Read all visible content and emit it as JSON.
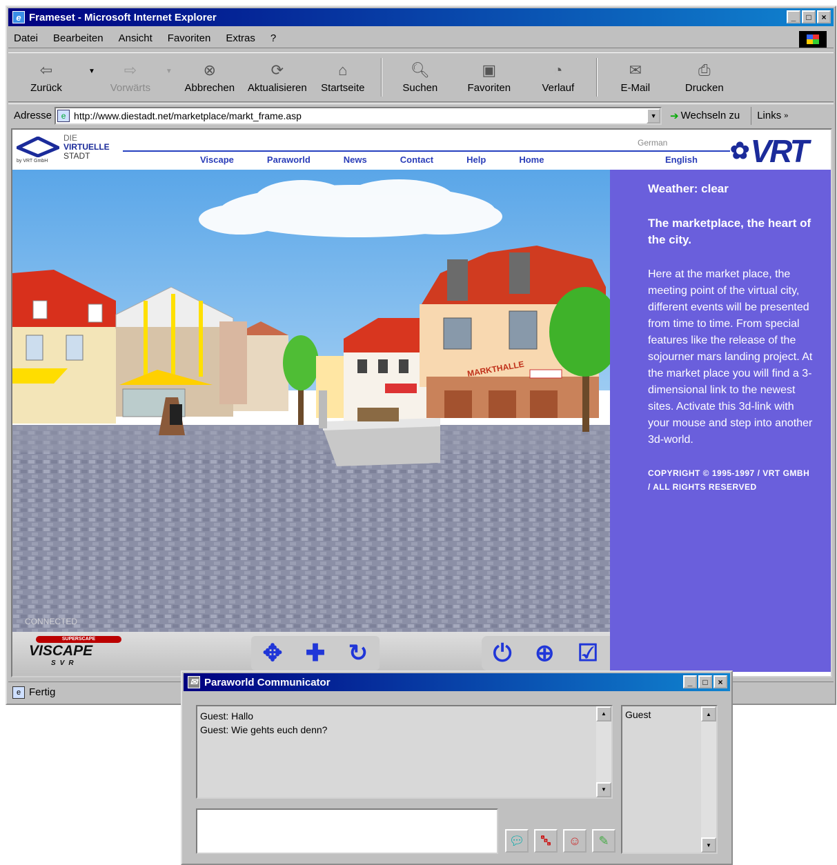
{
  "window": {
    "title": "Frameset - Microsoft Internet Explorer",
    "controls": [
      "_",
      "□",
      "×"
    ]
  },
  "menu": [
    "Datei",
    "Bearbeiten",
    "Ansicht",
    "Favoriten",
    "Extras",
    "?"
  ],
  "toolbar": {
    "back": "Zurück",
    "forward": "Vorwärts",
    "stop": "Abbrechen",
    "refresh": "Aktualisieren",
    "home": "Startseite",
    "search": "Suchen",
    "favorites": "Favoriten",
    "history": "Verlauf",
    "mail": "E-Mail",
    "print": "Drucken"
  },
  "address": {
    "label": "Adresse",
    "url": "http://www.diestadt.net/marketplace/markt_frame.asp",
    "go": "Wechseln zu",
    "links": "Links"
  },
  "site": {
    "logo_die": "DIE",
    "logo_virtuelle": "VIRTUELLE",
    "logo_stadt": "STADT",
    "logo_sub": "by VRT GmbH",
    "nav": [
      "Viscape",
      "Paraworld",
      "News",
      "Contact",
      "Help",
      "Home"
    ],
    "lang_german": "German",
    "lang_english": "English",
    "brand": "VRT"
  },
  "sidebar": {
    "weather": "Weather: clear",
    "heading": "The marketplace, the heart of the city.",
    "body": "Here at the market place, the meeting point of the virtual city, different events will be presented from time to time. From special features like the release of the sojourner mars landing project. At the market place you will find a 3-dimensional link to the newest sites. Activate this 3d-link with your mouse and step into another 3d-world.",
    "copyright": "COPYRIGHT © 1995-1997 / VRT GMBH / ALL RIGHTS RESERVED"
  },
  "scene": {
    "connected": "CONNECTED",
    "sign_markthalle": "MARKTHALLE"
  },
  "viscape": {
    "top": "SUPERSCAPE",
    "name": "VISCAPE",
    "bottom": "SVR"
  },
  "status": "Fertig",
  "communicator": {
    "title": "Paraworld Communicator",
    "messages": [
      "Guest: Hallo",
      "Guest: Wie gehts euch denn?"
    ],
    "users": [
      "Guest"
    ],
    "input_value": ""
  }
}
